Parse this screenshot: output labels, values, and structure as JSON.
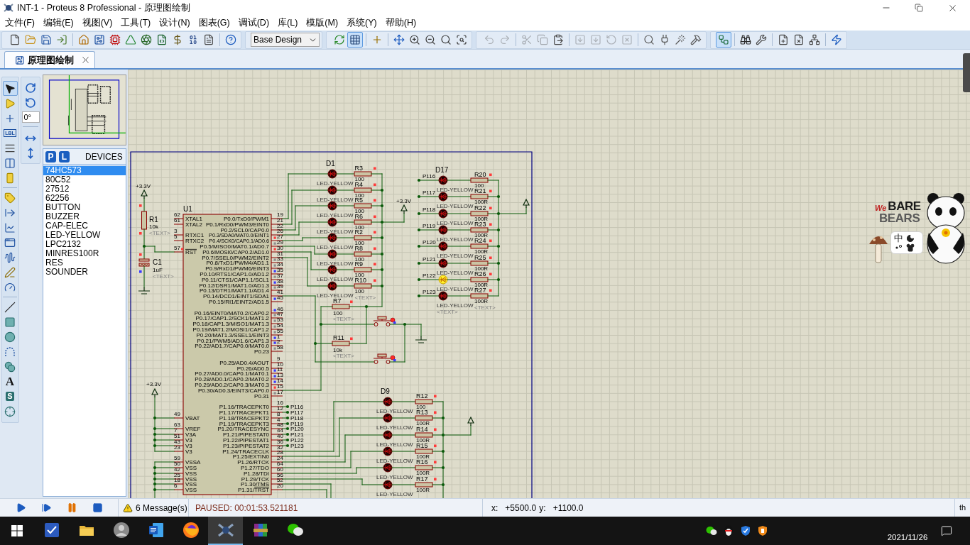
{
  "window": {
    "title": "INT-1 - Proteus 8 Professional - 原理图绘制"
  },
  "menu": [
    "文件(F)",
    "编辑(E)",
    "视图(V)",
    "工具(T)",
    "设计(N)",
    "图表(G)",
    "调试(D)",
    "库(L)",
    "模版(M)",
    "系统(Y)",
    "帮助(H)"
  ],
  "toolbar": {
    "bands": [
      {
        "groups": [
          [
            {
              "kind": "new",
              "pressed": false,
              "disabled": false
            },
            {
              "kind": "open",
              "pressed": false,
              "disabled": false
            },
            {
              "kind": "save",
              "pressed": false,
              "disabled": false
            },
            {
              "kind": "import",
              "pressed": false,
              "disabled": false
            }
          ],
          [
            {
              "kind": "home",
              "pressed": false,
              "disabled": false
            },
            {
              "kind": "schematic",
              "pressed": false,
              "disabled": false
            },
            {
              "kind": "pcb",
              "pressed": false,
              "disabled": false
            },
            {
              "kind": "visualizer",
              "pressed": false,
              "disabled": false
            },
            {
              "kind": "gerber",
              "pressed": false,
              "disabled": false
            },
            {
              "kind": "explorer",
              "pressed": false,
              "disabled": false
            },
            {
              "kind": "bom",
              "pressed": false,
              "disabled": false
            },
            {
              "kind": "ascii",
              "pressed": false,
              "disabled": false
            },
            {
              "kind": "notes",
              "pressed": false,
              "disabled": false
            }
          ],
          [
            {
              "kind": "help",
              "pressed": false,
              "disabled": false
            }
          ]
        ]
      },
      {
        "dropdown": "Base Design"
      },
      {
        "groups": [
          [
            {
              "kind": "refresh",
              "pressed": false,
              "disabled": false
            },
            {
              "kind": "grid",
              "pressed": true,
              "disabled": false
            }
          ],
          [
            {
              "kind": "origin",
              "pressed": false,
              "disabled": false
            }
          ],
          [
            {
              "kind": "pan",
              "pressed": false,
              "disabled": false
            },
            {
              "kind": "zoom_in",
              "pressed": false,
              "disabled": false
            },
            {
              "kind": "zoom_out",
              "pressed": false,
              "disabled": false
            },
            {
              "kind": "zoom_all",
              "pressed": false,
              "disabled": false
            },
            {
              "kind": "zoom_area",
              "pressed": false,
              "disabled": false
            }
          ]
        ]
      },
      {
        "groups": [
          [
            {
              "kind": "undo",
              "pressed": false,
              "disabled": true
            },
            {
              "kind": "redo",
              "pressed": false,
              "disabled": true
            }
          ],
          [
            {
              "kind": "cut",
              "pressed": false,
              "disabled": true
            },
            {
              "kind": "copy",
              "pressed": false,
              "disabled": true
            },
            {
              "kind": "paste",
              "pressed": false,
              "disabled": false
            }
          ],
          [
            {
              "kind": "block_copy",
              "pressed": false,
              "disabled": true
            },
            {
              "kind": "block_move",
              "pressed": false,
              "disabled": true
            },
            {
              "kind": "block_rotate",
              "pressed": false,
              "disabled": true
            },
            {
              "kind": "block_delete",
              "pressed": false,
              "disabled": true
            }
          ],
          [
            {
              "kind": "pick",
              "pressed": false,
              "disabled": false
            },
            {
              "kind": "make_device",
              "pressed": false,
              "disabled": false
            },
            {
              "kind": "package",
              "pressed": false,
              "disabled": false
            },
            {
              "kind": "decompose",
              "pressed": false,
              "disabled": false
            }
          ]
        ]
      },
      {
        "groups": [
          [
            {
              "kind": "autorouter",
              "pressed": true,
              "disabled": false
            }
          ],
          [
            {
              "kind": "search_tag",
              "pressed": false,
              "disabled": false
            },
            {
              "kind": "property",
              "pressed": false,
              "disabled": false
            }
          ],
          [
            {
              "kind": "new_sheet",
              "pressed": false,
              "disabled": false
            },
            {
              "kind": "remove_sheet",
              "pressed": false,
              "disabled": false
            },
            {
              "kind": "goto_sheet",
              "pressed": false,
              "disabled": false
            }
          ],
          [
            {
              "kind": "netlist",
              "pressed": false,
              "disabled": false
            }
          ]
        ]
      }
    ]
  },
  "tab_bar": {
    "tabs": [
      {
        "label": "原理图绘制",
        "selected": true
      }
    ]
  },
  "tools": {
    "groups": [
      [
        {
          "kind": "select",
          "selected": true
        },
        {
          "kind": "component",
          "selected": false
        },
        {
          "kind": "junction",
          "selected": false
        },
        {
          "kind": "label",
          "glyph": "LBL",
          "selected": false
        },
        {
          "kind": "script",
          "selected": false
        },
        {
          "kind": "bus",
          "selected": false
        },
        {
          "kind": "subcircuit",
          "selected": false
        }
      ],
      [
        {
          "kind": "terminal",
          "selected": false
        },
        {
          "kind": "device_pin",
          "selected": false
        },
        {
          "kind": "graph",
          "selected": false
        },
        {
          "kind": "tape",
          "selected": false
        },
        {
          "kind": "generator",
          "selected": false
        },
        {
          "kind": "probe",
          "selected": false
        },
        {
          "kind": "instrument",
          "selected": false
        }
      ],
      [
        {
          "kind": "line",
          "selected": false
        },
        {
          "kind": "box",
          "selected": false
        },
        {
          "kind": "circle",
          "selected": false
        },
        {
          "kind": "arc",
          "selected": false
        },
        {
          "kind": "path",
          "selected": false
        },
        {
          "kind": "text",
          "glyph": "A",
          "selected": false
        },
        {
          "kind": "symbol",
          "glyph": "S",
          "selected": false
        },
        {
          "kind": "marker",
          "selected": false
        }
      ]
    ]
  },
  "orientation": {
    "rotate": [
      {
        "kind": "rotate_cw"
      },
      {
        "kind": "rotate_ccw"
      }
    ],
    "angle": "0°",
    "flip": [
      {
        "kind": "flip_horizontal"
      },
      {
        "kind": "flip_vertical"
      }
    ]
  },
  "devices": {
    "buttons": [
      "P",
      "L"
    ],
    "title": "DEVICES",
    "items": [
      {
        "label": "74HC573",
        "selected": true
      },
      {
        "label": "80C52",
        "selected": false
      },
      {
        "label": "27512",
        "selected": false
      },
      {
        "label": "62256",
        "selected": false
      },
      {
        "label": "BUTTON",
        "selected": false
      },
      {
        "label": "BUZZER",
        "selected": false
      },
      {
        "label": "CAP-ELEC",
        "selected": false
      },
      {
        "label": "LED-YELLOW",
        "selected": false
      },
      {
        "label": "LPC2132",
        "selected": false
      },
      {
        "label": "MINRES100R",
        "selected": false
      },
      {
        "label": "RES",
        "selected": false
      },
      {
        "label": "SOUNDER",
        "selected": false
      }
    ]
  },
  "schematic": {
    "mcu": {
      "ref": "U1",
      "left_top": [
        [
          {
            "name": "XTAL1",
            "number": "62"
          },
          {
            "name": "XTAL2",
            "number": "61"
          }
        ],
        [
          {
            "name": "RTXC1",
            "number": "3"
          },
          {
            "name": "RTXC2",
            "number": "5"
          }
        ],
        [
          {
            "name_overlined": "RST",
            "number": "57",
            "color": "#ff3a3a"
          }
        ]
      ],
      "left_bottom": [
        [
          {
            "name": "VBAT",
            "number": "49"
          }
        ],
        [
          {
            "name": "VREF",
            "number": "63"
          },
          {
            "name": "V3A",
            "number": "7"
          },
          {
            "name": "V3",
            "number": "51"
          },
          {
            "name": "V3",
            "number": "43"
          },
          {
            "name": "V3",
            "number": "23"
          }
        ],
        [
          {
            "name": "VSSA",
            "number": "59"
          },
          {
            "name": "VSS",
            "number": "50"
          },
          {
            "name": "VSS",
            "number": "42"
          },
          {
            "name": "VSS",
            "number": "25"
          },
          {
            "name": "VSS",
            "number": "18"
          },
          {
            "name": "VSS",
            "number": "6"
          }
        ]
      ],
      "right": [
        [
          {
            "name": "P0.0/TxD0/PWM1",
            "number": "19"
          },
          {
            "name": "P0.1/RxD0/PWM3/EINT0",
            "number": "21"
          },
          {
            "name": "P0.2/SCL0/CAP0.0",
            "number": "22"
          },
          {
            "name": "P0.3/SDA0/MAT0.0/EINT1",
            "number": "26"
          },
          {
            "name": "P0.4/SCK0/CAP0.1/AD0.6",
            "number": "27",
            "color": "#ff3a3a"
          },
          {
            "name": "P0.5/MISO0/MAT0.1/AD0.7",
            "number": "29",
            "color": "#8e8e8e"
          },
          {
            "name": "P0.6/MOSI0/CAP0.2/AD1.0",
            "number": "30",
            "color": "#ff3a3a"
          },
          {
            "name": "P0.7/SSEL0/PWM2/EINT2",
            "number": "31"
          },
          {
            "name": "P0.8/TxD1/PWM4/AD1.1",
            "number": "33",
            "color": "#8e8e8e"
          },
          {
            "name": "P0.9/RxD1/PWM6/EINT3",
            "number": "34",
            "color": "#8e8e8e"
          },
          {
            "name": "P0.10/RTS1/CAP1.0/AD1.2",
            "number": "35",
            "color": "#3a3aff"
          },
          {
            "name": "P0.11/CTS1/CAP1.1/SCL1",
            "number": "37",
            "color": "#8e8e8e"
          },
          {
            "name": "P0.12/DSR1/MAT1.0/AD1.3",
            "number": "38",
            "color": "#3a3aff"
          },
          {
            "name": "P0.13/DTR1/MAT1.1/AD1.4",
            "number": "39",
            "color": "#8e8e8e"
          },
          {
            "name": "P0.14/DCD1/EINT1/SDA1",
            "number": "41"
          },
          {
            "name": "P0.15/RI1/EINT2/AD1.5",
            "number": "45",
            "color": "#3a3aff"
          }
        ],
        [
          {
            "name": "P0.16/EINT0/MAT0.2/CAP0.2",
            "number": "46",
            "color": "#3a3aff"
          },
          {
            "name": "P0.17/CAP1.2/SCK1/MAT1.2",
            "number": "47",
            "color": "#8e8e8e"
          },
          {
            "name": "P0.18/CAP1.3/MISO1/MAT1.3",
            "number": "53",
            "color": "#8e8e8e"
          },
          {
            "name": "P0.19/MAT1.2/MOSI1/CAP1.2",
            "number": "54",
            "color": "#8e8e8e"
          },
          {
            "name": "P0.20/MAT1.3/SSEL1/EINT3",
            "number": "55",
            "color": "#8e8e8e"
          },
          {
            "name": "P0.21/PWM5/AD1.6/CAP1.3",
            "number": "1",
            "color": "#3a3aff"
          },
          {
            "name": "P0.22/AD1.7/CAP0.0/MAT0.0",
            "number": "2",
            "color": "#3a3aff"
          },
          {
            "name": "P0.23",
            "number": "58",
            "color": "#8e8e8e"
          }
        ],
        [
          {
            "name": "P0.25/AD0.4/AOUT",
            "number": "9"
          },
          {
            "name": "P0.26/AD0.5",
            "number": "10"
          },
          {
            "name": "P0.27/AD0.0/CAP0.1/MAT0.1",
            "number": "11",
            "color": "#3a3aff"
          },
          {
            "name": "P0.28/AD0.1/CAP0.2/MAT0.2",
            "number": "13",
            "color": "#3a3aff"
          },
          {
            "name": "P0.29/AD0.2/CAP0.3/MAT0.3",
            "number": "14",
            "color": "#3a3aff"
          },
          {
            "name": "P0.30/AD0.3/EINT3/CAP0.0",
            "number": "15",
            "color": "#ff3a3a"
          },
          {
            "name": "P0.31",
            "number": "17",
            "color": "#8e8e8e"
          }
        ],
        [
          {
            "name": "P1.16/TRACEPKT0",
            "number": "16",
            "net": "P116"
          },
          {
            "name": "P1.17/TRACEPKT1",
            "number": "12",
            "net": "P117"
          },
          {
            "name": "P1.18/TRACEPKT2",
            "number": "8",
            "net": "P118"
          },
          {
            "name": "P1.19/TRACEPKT3",
            "number": "4",
            "net": "P119"
          },
          {
            "name": "P1.20/TRACESYNC",
            "number": "48",
            "net": "P120"
          },
          {
            "name": "P1.21/PIPESTAT0",
            "number": "44",
            "net": "P121"
          },
          {
            "name": "P1.22/PIPESTAT1",
            "number": "40",
            "net": "P122"
          },
          {
            "name": "P1.23/PIPESTAT2",
            "number": "36",
            "net": "P123"
          },
          {
            "name": "P1.24/TRACECLK",
            "number": "32"
          },
          {
            "name": "P1.25/EXTIN0",
            "number": "28"
          },
          {
            "name": "P1.26/RTCK",
            "number": "24"
          },
          {
            "name": "P1.27/TDO",
            "number": "64"
          },
          {
            "name": "P1.28/TDI",
            "number": "60"
          },
          {
            "name": "P1.29/TCK",
            "number": "56"
          },
          {
            "name": "P1.30/TMS",
            "number": "52"
          },
          {
            "name": "P1.31/",
            "name_overlined": "TRST",
            "number": "20"
          }
        ]
      ]
    },
    "reset": {
      "supply": "+3.3V",
      "resistor": {
        "ref": "R1",
        "value": "10k",
        "text": "<TEXT>",
        "markers": [
          {
            "color": "#ff3a3a"
          },
          {
            "color": "#ff3a3a"
          }
        ]
      },
      "capacitor": {
        "ref": "C1",
        "value": "1uF",
        "text": "<TEXT>",
        "markers": [
          {
            "color": "#ff3a3a"
          },
          {
            "color": "#3a3aff"
          }
        ]
      }
    },
    "power": {
      "supply": "+3.3V"
    },
    "bank_1": {
      "first_led": "D1",
      "supply": "+3.3V",
      "rows": [
        {
          "led_type": "LED-YELLOW",
          "lit": false,
          "resistor": "R3",
          "value": "100",
          "color": "#ff3a3a"
        },
        {
          "led_type": "LED-YELLOW",
          "lit": false,
          "resistor": "R4",
          "value": "100",
          "color": "#ff3a3a"
        },
        {
          "led_type": "LED-YELLOW",
          "lit": false,
          "resistor": "R5",
          "value": "100",
          "color": "#ff3a3a"
        },
        {
          "led_type": "LED-YELLOW",
          "lit": false,
          "resistor": "R6",
          "value": "100",
          "color": "#ff3a3a"
        },
        {
          "led_type": "LED-YELLOW",
          "lit": false,
          "resistor": "R2",
          "value": "100",
          "color": "#ff3a3a"
        },
        {
          "led_type": "LED-YELLOW",
          "lit": false,
          "resistor": "R8",
          "value": "100",
          "color": "#ff3a3a"
        },
        {
          "led_type": "LED-YELLOW",
          "lit": false,
          "resistor": "R9",
          "value": "100",
          "color": "#ff3a3a"
        },
        {
          "led_type": "LED-YELLOW",
          "lit": false,
          "resistor": "R10",
          "value": "100",
          "color": "#ff3a3a",
          "text": "<TEXT>"
        }
      ]
    },
    "pullups": [
      {
        "ref": "R7",
        "value": "100",
        "text": "<TEXT>",
        "color": "#ff3a3a"
      },
      {
        "ref": "R11",
        "value": "10k",
        "text": "<TEXT>",
        "color": "#ff3a3a"
      }
    ],
    "bank_2": {
      "first_led": "D17",
      "rows": [
        {
          "net": "P116",
          "led_type": "LED-YELLOW",
          "lit": false,
          "resistor": "R20",
          "value": "100",
          "color": "#ff3a3a"
        },
        {
          "net": "P117",
          "led_type": "LED-YELLOW",
          "lit": false,
          "resistor": "R21",
          "value": "100R",
          "color": "#ff3a3a"
        },
        {
          "net": "P118",
          "led_type": "LED-YELLOW",
          "lit": false,
          "resistor": "R22",
          "value": "100R",
          "color": "#ff3a3a"
        },
        {
          "net": "P119",
          "led_type": "LED-YELLOW",
          "lit": false,
          "resistor": "R23",
          "value": "100R",
          "color": "#ff3a3a"
        },
        {
          "net": "P120",
          "led_type": "LED-YELLOW",
          "lit": false,
          "resistor": "R24",
          "value": "100R",
          "color": "#ff3a3a"
        },
        {
          "net": "P121",
          "led_type": "LED-YELLOW",
          "lit": false,
          "resistor": "R25",
          "value": "100R",
          "color": "#ff3a3a"
        },
        {
          "net": "P122",
          "led_type": "LED-YELLOW",
          "lit": true,
          "resistor": "R26",
          "value": "100R",
          "color": "#ff3a3a"
        },
        {
          "net": "P123",
          "led_type": "LED-YELLOW",
          "lit": false,
          "resistor": "R27",
          "value": "100R",
          "color": "#ff3a3a",
          "text": "<TEXT>",
          "led_text": "<TEXT>"
        }
      ]
    },
    "bank_3": {
      "first_led": "D9",
      "rows": [
        {
          "led_type": "LED-YELLOW",
          "lit": false,
          "resistor": "R12",
          "value": "100",
          "color": "#ff3a3a"
        },
        {
          "led_type": "LED-YELLOW",
          "lit": false,
          "resistor": "R13",
          "value": "100R",
          "color": "#ff3a3a"
        },
        {
          "led_type": "LED-YELLOW",
          "lit": false,
          "resistor": "R14",
          "value": "100R",
          "color": "#ff3a3a"
        },
        {
          "led_type": "LED-YELLOW",
          "lit": false,
          "resistor": "R15",
          "value": "100R",
          "color": "#ff3a3a"
        },
        {
          "led_type": "LED-YELLOW",
          "lit": false,
          "resistor": "R16",
          "value": "100R",
          "color": "#ff3a3a"
        },
        {
          "led_type": "LED-YELLOW",
          "lit": false,
          "resistor": "R17",
          "value": "100R",
          "color": "#ff3a3a"
        }
      ]
    }
  },
  "ime_widget": {
    "logo_small": "We",
    "logo_line_1": "BARE",
    "logo_line_2": "BEARS",
    "mode": "中"
  },
  "status_bar": {
    "controls": [
      {
        "kind": "play"
      },
      {
        "kind": "step"
      },
      {
        "kind": "pause"
      },
      {
        "kind": "stop"
      }
    ],
    "messages": "6 Message(s)",
    "status": "PAUSED: 00:01:53.521181",
    "x_label": "x:",
    "x_value": "+5500.0",
    "y_label": "y:",
    "y_value": "+1100.0",
    "edge_text": "th"
  },
  "taskbar": {
    "apps": [
      {
        "kind": "tile",
        "active": false
      },
      {
        "kind": "folder",
        "active": false
      },
      {
        "kind": "avatar",
        "active": false
      },
      {
        "kind": "document",
        "active": false
      },
      {
        "kind": "browser",
        "active": false
      },
      {
        "kind": "schematic_app",
        "active": true
      },
      {
        "kind": "archive",
        "active": false
      },
      {
        "kind": "chat",
        "active": false
      }
    ],
    "tray": [
      {
        "kind": "chat"
      },
      {
        "kind": "penguin"
      },
      {
        "kind": "shield"
      },
      {
        "kind": "shield_orange"
      }
    ],
    "date": "2021/11/26"
  }
}
